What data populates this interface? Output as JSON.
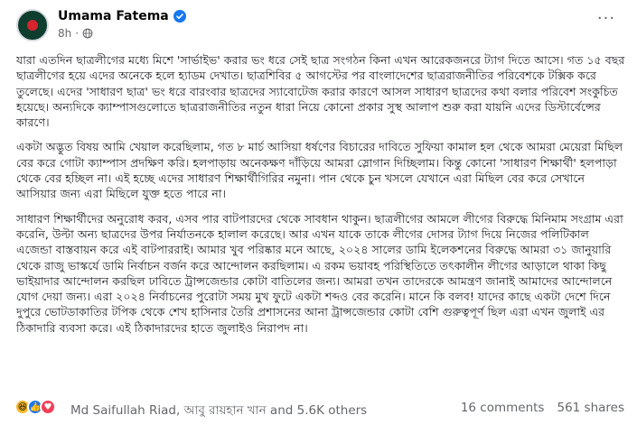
{
  "post": {
    "author": "Umama Fatema",
    "time": "8h",
    "more_label": "···",
    "paragraphs": [
      "যারা এতদিন ছাত্রলীগের মধ্যে মিশে 'সার্ভাইভ' করার ভং ধরে সেই ছাত্র সংগঠন কিনা এখন আরেকজনরে ট্যাগ দিতে আসে। গত ১৫ বছর ছাত্রলীগের হয়ে এদের অনেকে হলে হ্যাডম দেখাত। ছাত্রশিবির ৫ আগস্টের পর বাংলাদেশের ছাত্ররাজনীতির পরিবেশকে টক্সিক করে তুলেছে। এদের 'সাধারণ ছাত্র' ভং ধরে বারংবার ছাত্রদের স্যাবোটেজ করার কারণে আসল সাধারণ ছাত্রদের কথা বলার পরিবেশ সংকুচিত হয়েছে। অন্যদিকে ক্যাম্পাসগুলোতে ছাত্ররাজনীতির নতুন ধারা নিয়ে কোনো প্রকার সুস্থ আলাপ শুরু করা যায়নি এদের ডিস্টার্বেন্সের কারণে।",
      "একটা অদ্ভুত বিষয় আমি খেয়াল করেছিলাম, গত ৮ মার্চ আসিয়া ধর্ষণের বিচারের দাবিতে সুফিয়া কামাল হল থেকে আমরা মেয়েরা মিছিল বের করে গোটা ক্যাম্পাস প্রদক্ষিণ করি। হলপাড়ায় অনেকক্ষণ দাঁড়িয়ে আমরা স্লোগান দিচ্ছিলাম। কিন্তু কোনো 'সাধারণ শিক্ষার্থী' হলপাড়া থেকে বের হচ্ছিল না। এই হচ্ছে এদের সাধারণ শিক্ষার্থীগিরির নমুনা। পান থেকে চুন খসলে যেখানে এরা মিছিল বের করে সেখানে আসিয়ার জন্য এরা মিছিলে যুক্ত হতে পারে না।",
      "সাধারণ শিক্ষার্থীদের অনুরোধ করব, এসব পার বাটপারদের থেকে সাবধান থাকুন। ছাত্রলীগের আমলে লীগের বিরুদ্ধে মিনিমাম সংগ্রাম এরা করেনি, উল্টা অন্য ছাত্রদের উপর নির্যাতনকে হালাল করেছে। আর এখন যাকে তাকে লীগের দোসর ট্যাগ দিয়ে নিজের পলিটিকাল এজেন্ডা বাস্তবায়ন করে এই বাটপাররাই। আমার খুব পরিষ্কার মনে আছে, ২০২৪ সালের ডামি ইলেকশনের বিরুদ্ধে আমরা ৩১ জানুয়ারি থেকে রাজু ভাস্কর্যে ডামি নির্বাচন বর্জন করে আন্দোলন করছিলাম। এ রকম ভয়াবহ পরিস্থিতিতে তৎকালীন লীগের আড়ালে থাকা কিছু ভাইয়াদার আন্দোলন করছিল ঢাবিতে ট্রান্সজেন্ডার কোটা বাতিলের জন্য। আমরা তখন তাদেরকে আমন্ত্রণ জানাই আমাদের আন্দোলনে যোগ দেয়া জন্য। এরা ২০২৪ নির্বাচনের পুরোটা সময় মুখ ফুটে একটা শব্দও বের করেনি। মানে কি বলব! যাদের কাছে একটা দেশে দিনে দুপুরে ভোটডাকাতির টপিক থেকে শেখ হাসিনার তৈরি প্রশাসনের আনা ট্রান্সজেন্ডার কোটা বেশি গুরুত্বপূর্ণ ছিল এরা এখন জুলাই এর ঠিকাদারি ব্যবসা করে। এই ঠিকাদারদের হাতে জুলাইও নিরাপদ না।"
    ]
  },
  "footer": {
    "reactions_text": "Md Saifullah Riad, আবু রায়হান খান and 5.6K others",
    "comments": "16 comments",
    "shares": "561 shares"
  },
  "colors": {
    "verified": "#1877f2",
    "secondary_text": "#65676b"
  }
}
